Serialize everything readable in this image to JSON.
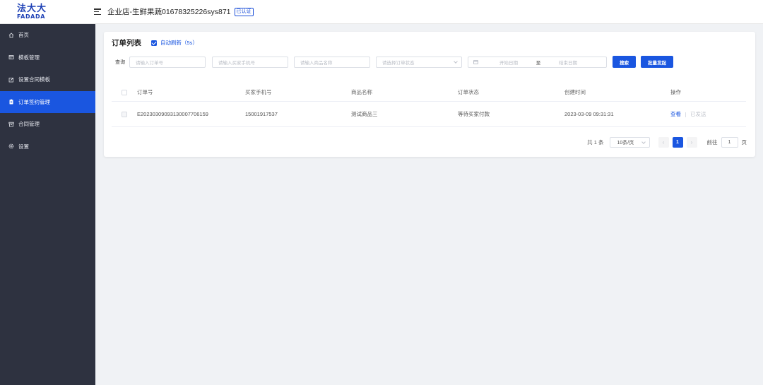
{
  "brand": {
    "logo_main": "法大大",
    "logo_sub": "FADADA"
  },
  "header": {
    "shop_title": "企业店-生鲜果蔬01678325226sys871",
    "badge": "已认证"
  },
  "sidebar": {
    "items": [
      {
        "label": "首页",
        "icon": "home-icon"
      },
      {
        "label": "模板管理",
        "icon": "template-icon"
      },
      {
        "label": "设置合同模板",
        "icon": "edit-icon"
      },
      {
        "label": "订单签约管理",
        "icon": "clipboard-icon",
        "active": true
      },
      {
        "label": "合同管理",
        "icon": "archive-icon"
      },
      {
        "label": "设置",
        "icon": "gear-icon"
      }
    ]
  },
  "card": {
    "title": "订单列表",
    "auto_refresh": {
      "label": "自动刷新（5s）",
      "checked": true
    }
  },
  "filters": {
    "label": "查询",
    "order_no_placeholder": "请输入订单号",
    "phone_placeholder": "请输入买家手机号",
    "product_placeholder": "请输入商品名称",
    "status_placeholder": "请选择订单状态",
    "start_date_placeholder": "开始日期",
    "range_sep": "至",
    "end_date_placeholder": "结束日期",
    "search_button": "搜索",
    "batch_button": "批量发起"
  },
  "table": {
    "columns": [
      "订单号",
      "买家手机号",
      "商品名称",
      "订单状态",
      "创建时间",
      "操作"
    ],
    "rows": [
      {
        "order_no": "E2023030909313000770615​9",
        "phone": "15001917537",
        "product": "测试商品三",
        "status": "等待买家付款",
        "created": "2023-03-09 09:31:31",
        "action_view": "查看",
        "action_sent": "已发送"
      }
    ]
  },
  "pagination": {
    "total": "共 1 条",
    "page_size": "10条/页",
    "current_page": "1",
    "goto_prefix": "前往",
    "goto_value": "1",
    "goto_suffix": "页"
  },
  "colors": {
    "primary": "#1a56e0",
    "sidebar": "#2e3240",
    "brand": "#1b3fb5"
  }
}
